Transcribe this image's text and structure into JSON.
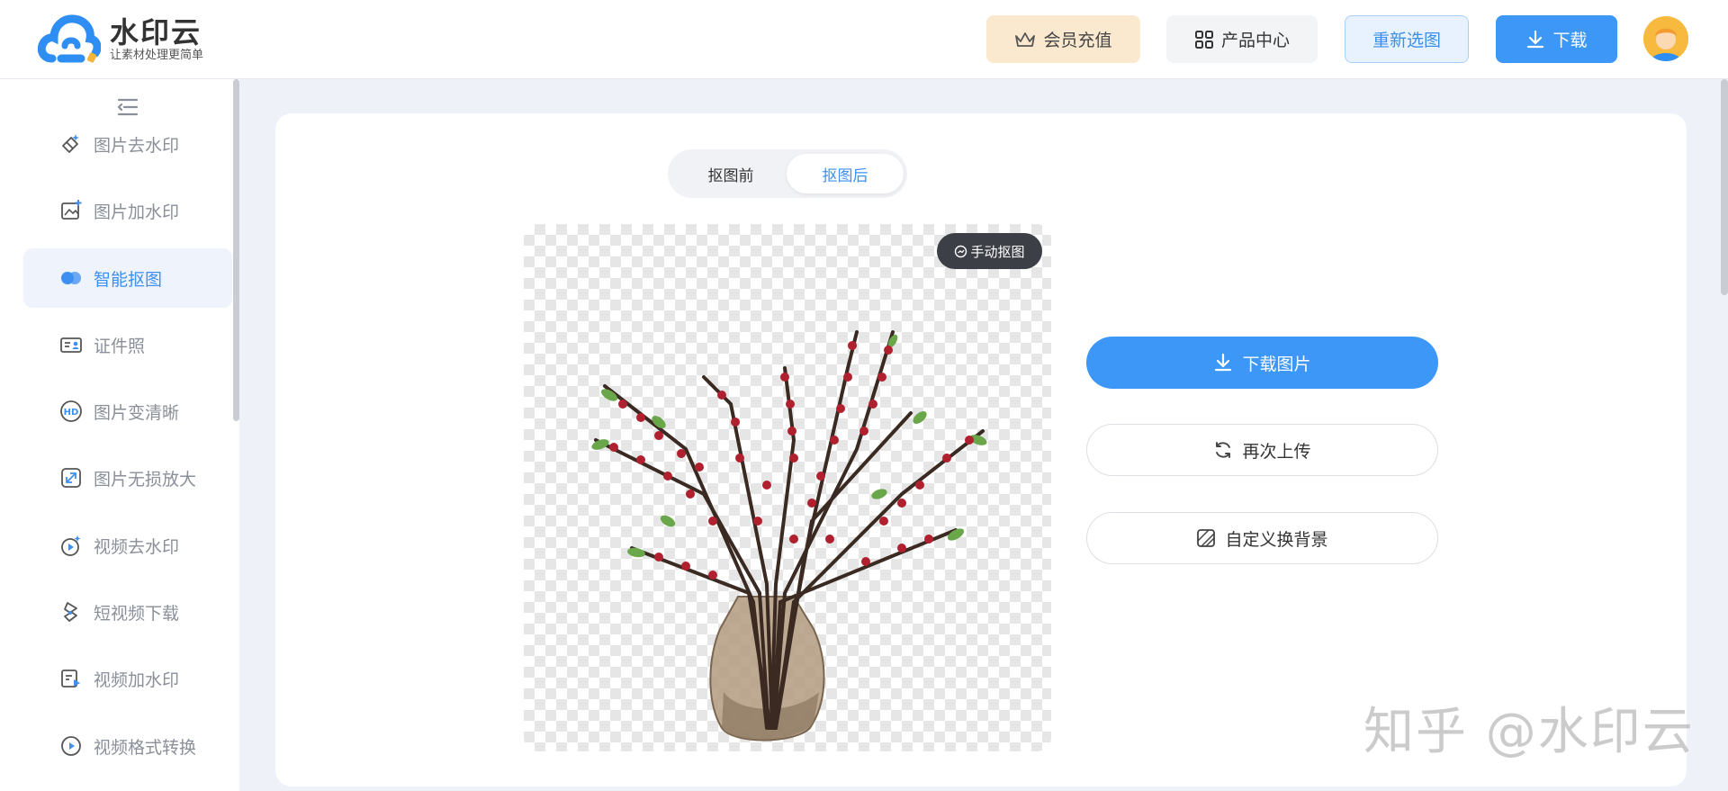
{
  "header": {
    "logo": {
      "title": "水印云",
      "slogan": "让素材处理更简单"
    },
    "vip_label": "会员充值",
    "products_label": "产品中心",
    "reselect_label": "重新选图",
    "download_label": "下载"
  },
  "sidebar": {
    "items": [
      {
        "label": "图片去水印",
        "icon": "eraser-icon"
      },
      {
        "label": "图片加水印",
        "icon": "image-add-icon"
      },
      {
        "label": "智能抠图",
        "icon": "smart-cutout-icon",
        "active": true
      },
      {
        "label": "证件照",
        "icon": "id-card-icon"
      },
      {
        "label": "图片变清晰",
        "icon": "hd-icon"
      },
      {
        "label": "图片无损放大",
        "icon": "expand-icon"
      },
      {
        "label": "视频去水印",
        "icon": "video-eraser-icon"
      },
      {
        "label": "短视频下载",
        "icon": "short-video-icon"
      },
      {
        "label": "视频加水印",
        "icon": "video-add-icon"
      },
      {
        "label": "视频格式转换",
        "icon": "video-convert-icon"
      }
    ]
  },
  "main": {
    "tabs": {
      "before": "抠图前",
      "after": "抠图后",
      "selected": "after"
    },
    "manual_label": "手动抠图",
    "actions": {
      "download": "下载图片",
      "reupload": "再次上传",
      "custom_bg": "自定义换背景"
    }
  },
  "watermark_text": "知乎 @水印云",
  "colors": {
    "accent": "#3d97f6",
    "vip_bg": "#fbe9cf",
    "active_nav": "#3d8ff0"
  }
}
